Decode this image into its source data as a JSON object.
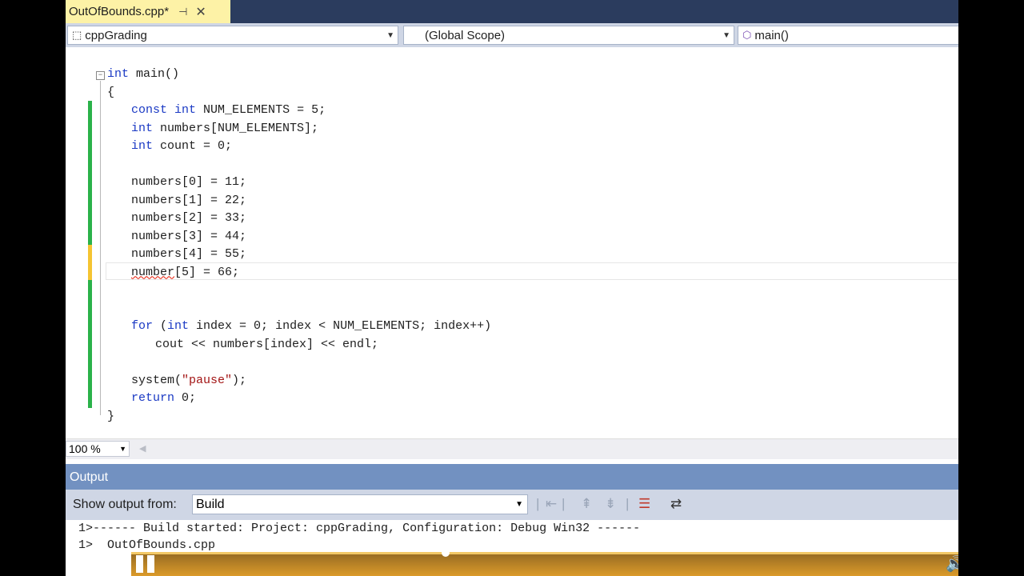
{
  "tab": {
    "title": "OutOfBounds.cpp*",
    "pin_glyph": "⊣",
    "close_glyph": "✕"
  },
  "nav": {
    "project": "cppGrading",
    "scope": "(Global Scope)",
    "member": "main()"
  },
  "editor": {
    "fold_glyph": "−",
    "lines": [
      {
        "indent": 0,
        "tokens": [
          {
            "t": "int",
            "c": "kw"
          },
          {
            "t": " main()"
          }
        ]
      },
      {
        "indent": 0,
        "tokens": [
          {
            "t": "{"
          }
        ]
      },
      {
        "indent": 1,
        "tokens": [
          {
            "t": "const",
            "c": "kw"
          },
          {
            "t": " "
          },
          {
            "t": "int",
            "c": "kw"
          },
          {
            "t": " NUM_ELEMENTS = 5;"
          }
        ]
      },
      {
        "indent": 1,
        "tokens": [
          {
            "t": "int",
            "c": "kw"
          },
          {
            "t": " numbers[NUM_ELEMENTS];"
          }
        ]
      },
      {
        "indent": 1,
        "tokens": [
          {
            "t": "int",
            "c": "kw"
          },
          {
            "t": " count = 0;"
          }
        ]
      },
      {
        "indent": 1,
        "tokens": []
      },
      {
        "indent": 1,
        "tokens": [
          {
            "t": "numbers[0] = 11;"
          }
        ]
      },
      {
        "indent": 1,
        "tokens": [
          {
            "t": "numbers[1] = 22;"
          }
        ]
      },
      {
        "indent": 1,
        "tokens": [
          {
            "t": "numbers[2] = 33;"
          }
        ]
      },
      {
        "indent": 1,
        "tokens": [
          {
            "t": "numbers[3] = 44;"
          }
        ]
      },
      {
        "indent": 1,
        "tokens": [
          {
            "t": "numbers[4] = 55;"
          }
        ]
      },
      {
        "indent": 1,
        "tokens": [
          {
            "t": "number",
            "c": "squiggle"
          },
          {
            "t": "[5] = 66;"
          }
        ]
      },
      {
        "indent": 1,
        "tokens": []
      },
      {
        "indent": 1,
        "tokens": []
      },
      {
        "indent": 1,
        "tokens": [
          {
            "t": "for",
            "c": "kw"
          },
          {
            "t": " ("
          },
          {
            "t": "int",
            "c": "kw"
          },
          {
            "t": " index = 0; index < NUM_ELEMENTS; index++)"
          }
        ]
      },
      {
        "indent": 2,
        "tokens": [
          {
            "t": "cout << numbers[index] << endl;"
          }
        ]
      },
      {
        "indent": 1,
        "tokens": []
      },
      {
        "indent": 1,
        "tokens": [
          {
            "t": "system("
          },
          {
            "t": "\"pause\"",
            "c": "str"
          },
          {
            "t": ");"
          }
        ]
      },
      {
        "indent": 1,
        "tokens": [
          {
            "t": "return",
            "c": "kw"
          },
          {
            "t": " 0;"
          }
        ]
      },
      {
        "indent": 0,
        "tokens": [
          {
            "t": "}"
          }
        ]
      }
    ]
  },
  "zoom": {
    "value": "100 %"
  },
  "output": {
    "title": "Output",
    "show_label": "Show output from:",
    "source": "Build",
    "lines": [
      "1>------ Build started: Project: cppGrading, Configuration: Debug Win32 ------",
      "1>  OutOfBounds.cpp"
    ]
  },
  "colors": {
    "keyword": "#1a39c4",
    "string": "#a31515",
    "tab_active": "#fdf2a6",
    "output_title": "#7291c1"
  }
}
